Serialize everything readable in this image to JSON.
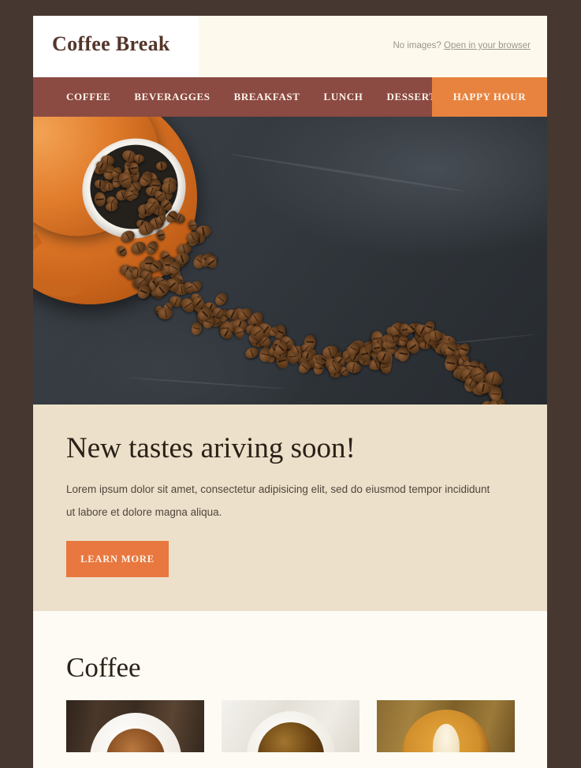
{
  "theme": {
    "page_background": "#463730",
    "header_background": "#fdfaed",
    "nav_background": "#8b4a42",
    "accent_orange": "#e8833f",
    "promo_background": "#ece0ca",
    "section_background": "#fdfbf4",
    "brand_text": "#54362a"
  },
  "header": {
    "logo": "Coffee Break",
    "preheader_prefix": "No images?",
    "preheader_link": "Open in your browser"
  },
  "nav": {
    "items": [
      {
        "label": "COFFEE"
      },
      {
        "label": "BEVERAGGES"
      },
      {
        "label": "BREAKFAST"
      },
      {
        "label": "LUNCH"
      },
      {
        "label": "DESSERTS"
      }
    ],
    "cta": "HAPPY HOUR"
  },
  "hero": {
    "image_alt": "orange coffee cup tipped over on dark slate with roasted coffee beans spilling out"
  },
  "promo": {
    "title": "New tastes ariving soon!",
    "body": "Lorem ipsum dolor sit amet, consectetur adipisicing elit, sed do eiusmod tempor incididunt ut labore et dolore magna aliqua.",
    "button": "LEARN MORE"
  },
  "coffee_section": {
    "title": "Coffee",
    "cards": [
      {
        "image_alt": "cappuccino with cinnamon topping on white saucer over dark wood"
      },
      {
        "image_alt": "black coffee in white cup on white cloth"
      },
      {
        "image_alt": "latte with rosetta latte art on wooden table"
      }
    ]
  }
}
